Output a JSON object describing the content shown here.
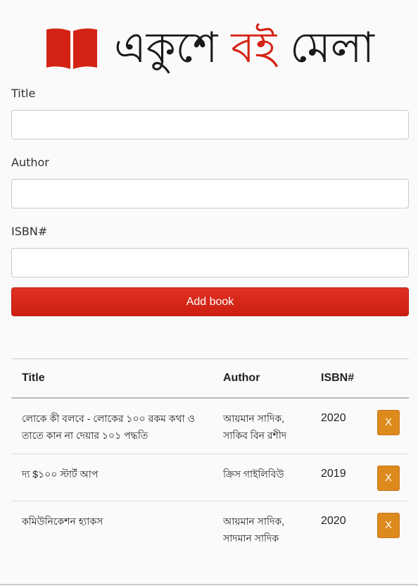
{
  "header": {
    "logo_icon": "open-book-icon",
    "brand_color": "#d42314",
    "title_parts": [
      "একুশে",
      "বই",
      "মেলা"
    ]
  },
  "form": {
    "title_label": "Title",
    "author_label": "Author",
    "isbn_label": "ISBN#",
    "title_value": "",
    "author_value": "",
    "isbn_value": "",
    "add_button_label": "Add book"
  },
  "table": {
    "headers": [
      "Title",
      "Author",
      "ISBN#"
    ],
    "rows": [
      {
        "title": "লোকে কী বলবে - লোকের ১০০ রকম কথা ও তাতে কান না দেয়ার ১০১ পদ্ধতি",
        "author": "আয়মান সাদিক, সাকিব বিন রশীদ",
        "isbn": "2020",
        "delete_label": "X"
      },
      {
        "title": "দ্য $১০০ স্টার্ট আপ",
        "author": "ক্রিস গাইলিবিউ",
        "isbn": "2019",
        "delete_label": "X"
      },
      {
        "title": "কমিউনিকেশন হ্যাকস",
        "author": "আয়মান সাদিক, সাদমান সাদিক",
        "isbn": "2020",
        "delete_label": "X"
      }
    ]
  },
  "colors": {
    "add_button": "#d42314",
    "delete_button": "#dd8a1c"
  }
}
